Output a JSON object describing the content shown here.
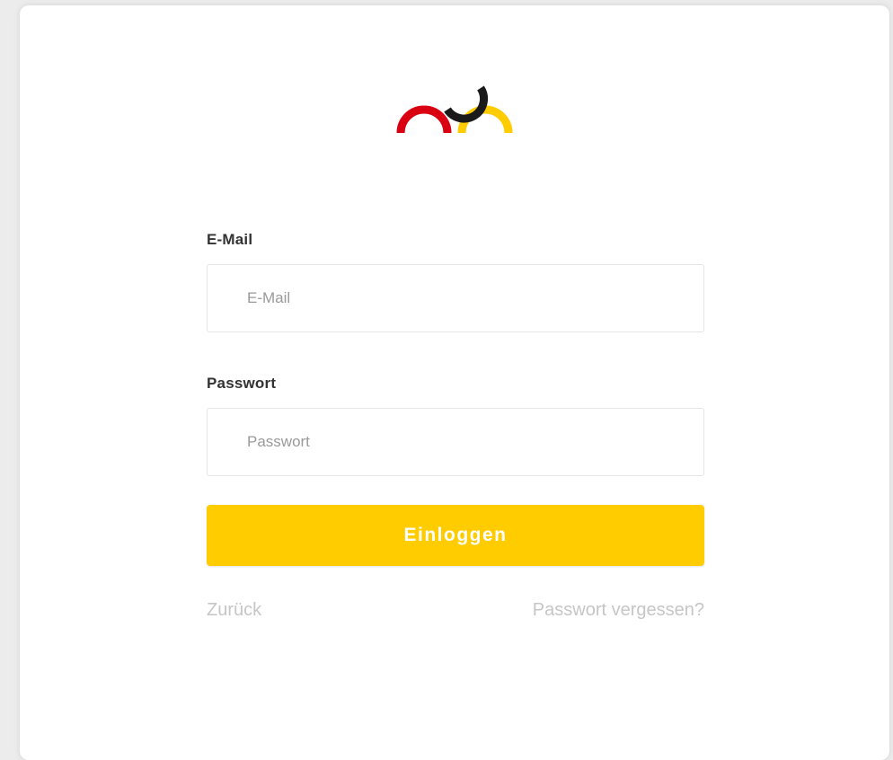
{
  "logo": {
    "icon": "brand-arcs-logo",
    "colors": {
      "red": "#d90012",
      "black": "#1a1a1a",
      "gold": "#ffcc00"
    }
  },
  "form": {
    "email": {
      "label": "E-Mail",
      "placeholder": "E-Mail",
      "value": ""
    },
    "password": {
      "label": "Passwort",
      "placeholder": "Passwort",
      "value": ""
    },
    "submit_label": "Einloggen",
    "submit_color": "#ffcc00"
  },
  "links": {
    "back": "Zurück",
    "forgot_password": "Passwort vergessen?"
  }
}
